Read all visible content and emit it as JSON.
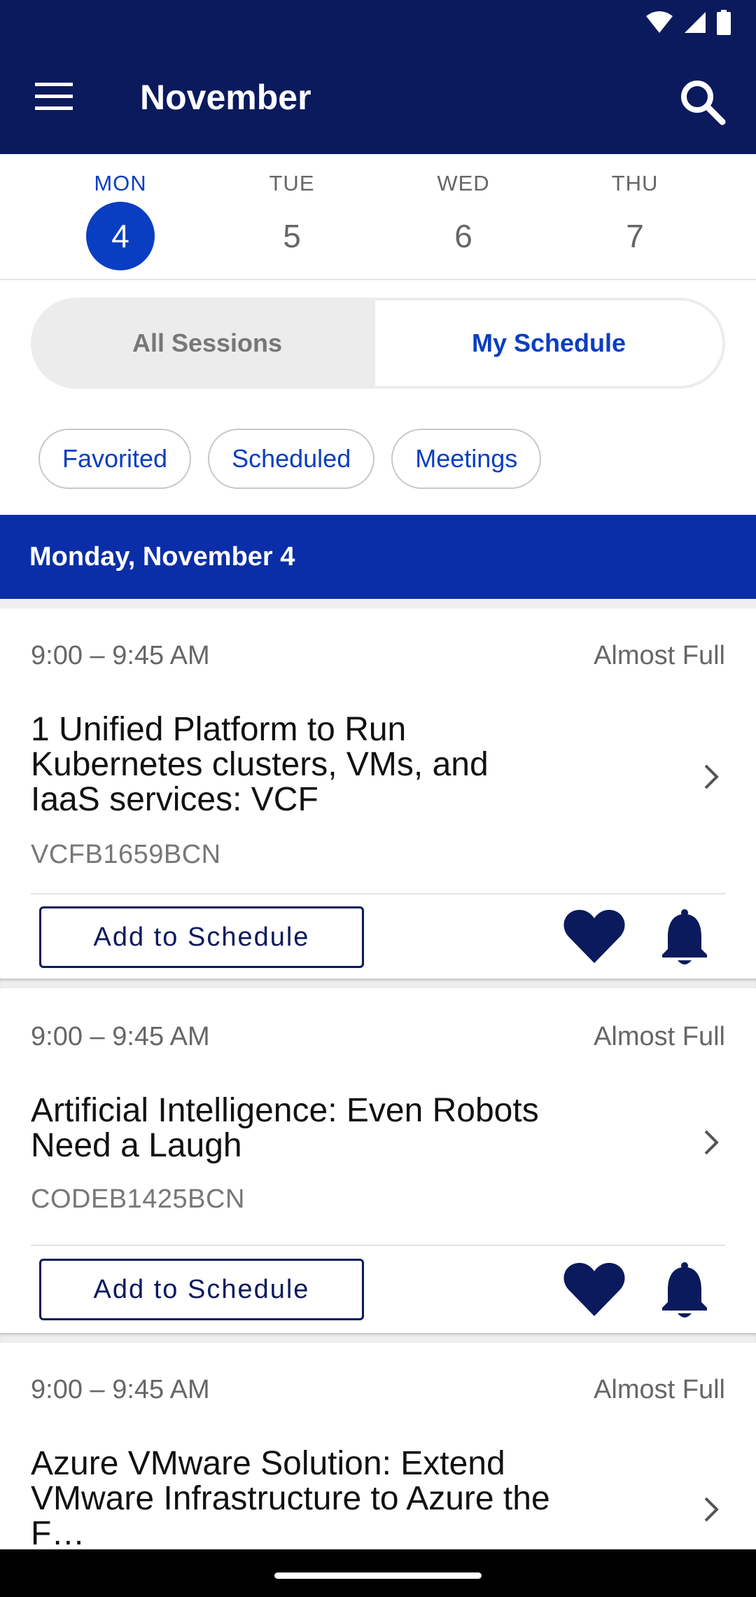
{
  "header": {
    "title": "November"
  },
  "days": [
    {
      "name": "MON",
      "num": "4"
    },
    {
      "name": "TUE",
      "num": "5"
    },
    {
      "name": "WED",
      "num": "6"
    },
    {
      "name": "THU",
      "num": "7"
    }
  ],
  "segment": {
    "all": "All Sessions",
    "my": "My Schedule",
    "selected": "My Schedule"
  },
  "chips": [
    "Favorited",
    "Scheduled",
    "Meetings"
  ],
  "date_header": "Monday, November 4",
  "sessions": [
    {
      "time": "9:00 – 9:45 AM",
      "availability": "Almost Full",
      "title": "1 Unified Platform to Run Kubernetes clusters, VMs, and IaaS services: VCF",
      "code": "VCFB1659BCN",
      "add_label": "Add to Schedule"
    },
    {
      "time": "9:00 – 9:45 AM",
      "availability": "Almost Full",
      "title": "Artificial Intelligence: Even Robots Need a Laugh",
      "code": "CODEB1425BCN",
      "add_label": "Add to Schedule"
    },
    {
      "time": "9:00 – 9:45 AM",
      "availability": "Almost Full",
      "title": "Azure VMware Solution: Extend VMware Infrastructure to Azure the F…"
    }
  ],
  "colors": {
    "header": "#0a1a5c",
    "accent": "#0a3ec2",
    "date_bar": "#0a2ea8"
  },
  "icons": [
    "wifi-icon",
    "signal-icon",
    "battery-icon",
    "menu-icon",
    "search-icon",
    "chevron-right-icon",
    "heart-icon",
    "bell-icon"
  ]
}
